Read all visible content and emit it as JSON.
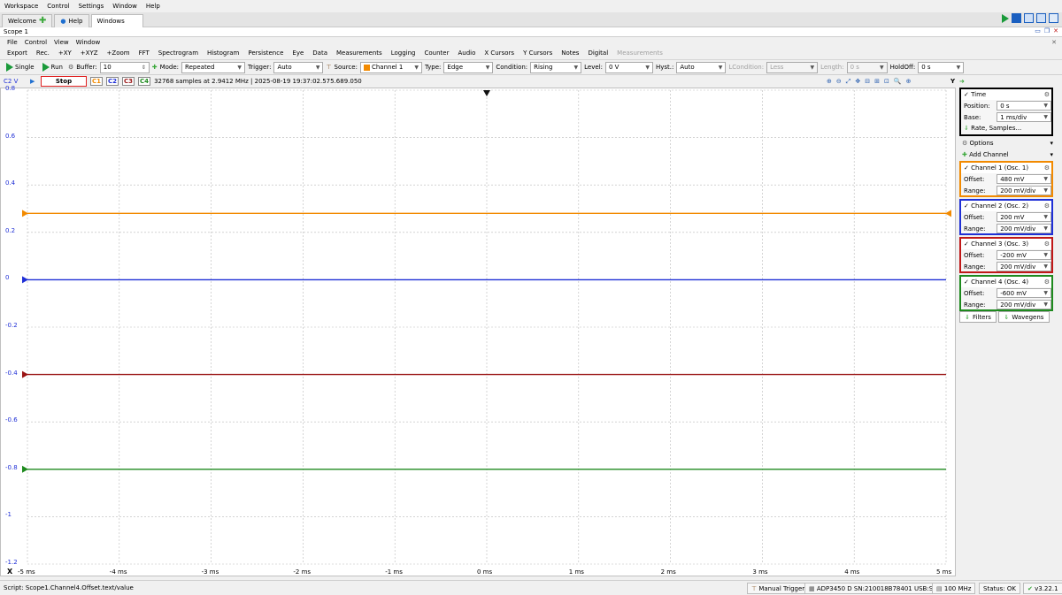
{
  "menubar": {
    "items": [
      "Workspace",
      "Control",
      "Settings",
      "Window",
      "Help"
    ]
  },
  "tabs": [
    {
      "label": "Welcome"
    },
    {
      "label": "Help"
    },
    {
      "label": "Windows"
    }
  ],
  "scope_title": "Scope 1",
  "submenu": {
    "items": [
      "File",
      "Control",
      "View",
      "Window"
    ]
  },
  "features": {
    "items": [
      "Export",
      "Rec.",
      "+XY",
      "+XYZ",
      "+Zoom",
      "FFT",
      "Spectrogram",
      "Histogram",
      "Persistence",
      "Eye",
      "Data",
      "Measurements",
      "Logging",
      "Counter",
      "Audio",
      "X Cursors",
      "Y Cursors",
      "Notes",
      "Digital"
    ],
    "disabled": "Measurements"
  },
  "controls": {
    "single": "Single",
    "run": "Run",
    "buffer_label": "Buffer:",
    "buffer_value": "10",
    "mode_label": "Mode:",
    "mode_value": "Repeated",
    "trigger_label": "Trigger:",
    "trigger_value": "Auto",
    "source_label": "Source:",
    "source_value": "Channel 1",
    "type_label": "Type:",
    "type_value": "Edge",
    "condition_label": "Condition:",
    "condition_value": "Rising",
    "level_label": "Level:",
    "level_value": "0 V",
    "hyst_label": "Hyst.:",
    "hyst_value": "Auto",
    "lcond_label": "LCondition:",
    "lcond_value": "Less",
    "length_label": "Length:",
    "length_value": "0 s",
    "holdoff_label": "HoldOff:",
    "holdoff_value": "0 s"
  },
  "info": {
    "axis_ch": "C2 V",
    "stop": "Stop",
    "ch_tags": [
      "C1",
      "C2",
      "C3",
      "C4"
    ],
    "ch_colors": [
      "#f28a00",
      "#1f2fd6",
      "#9a1414",
      "#1e8a1e"
    ],
    "status_text": "32768 samples at 2.9412 MHz | 2025-08-19 19:37:02.575.689.050",
    "y_button": "Y"
  },
  "y_ticks": [
    "0.8",
    "0.6",
    "0.4",
    "0.2",
    "0",
    "-0.2",
    "-0.4",
    "-0.6",
    "-0.8",
    "-1",
    "-1.2"
  ],
  "x_ticks": [
    "-5 ms",
    "-4 ms",
    "-3 ms",
    "-2 ms",
    "-1 ms",
    "0 ms",
    "1 ms",
    "2 ms",
    "3 ms",
    "4 ms",
    "5 ms"
  ],
  "x_button": "X",
  "traces": [
    {
      "channel": "C1",
      "level_v": 0.28,
      "color": "#f28a00"
    },
    {
      "channel": "C2",
      "level_v": 0.0,
      "color": "#1f2fd6"
    },
    {
      "channel": "C3",
      "level_v": -0.4,
      "color": "#9a1414"
    },
    {
      "channel": "C4",
      "level_v": -0.8,
      "color": "#1e8a1e"
    }
  ],
  "sidebar": {
    "time": {
      "title": "Time",
      "position_label": "Position:",
      "position": "0 s",
      "base_label": "Base:",
      "base": "1 ms/div",
      "rate": "Rate, Samples..."
    },
    "options": "Options",
    "add_channel": "Add Channel",
    "channels": [
      {
        "title": "Channel 1 (Osc. 1)",
        "offset": "480 mV",
        "range": "200 mV/div",
        "color": "#f28a00"
      },
      {
        "title": "Channel 2 (Osc. 2)",
        "offset": "200 mV",
        "range": "200 mV/div",
        "color": "#1f2fd6"
      },
      {
        "title": "Channel 3 (Osc. 3)",
        "offset": "-200 mV",
        "range": "200 mV/div",
        "color": "#c01818"
      },
      {
        "title": "Channel 4 (Osc. 4)",
        "offset": "-600 mV",
        "range": "200 mV/div",
        "color": "#1e8a1e"
      }
    ],
    "offset_label": "Offset:",
    "range_label": "Range:",
    "filters": "Filters",
    "wavegens": "Wavegens"
  },
  "status": {
    "script": "Script: Scope1.Channel4.Offset.text/value",
    "manual_trigger": "Manual Trigger",
    "device": "ADP3450 D SN:210018B78401 USB:ST",
    "freq": "100 MHz",
    "status": "Status: OK",
    "version": "v3.22.1"
  }
}
